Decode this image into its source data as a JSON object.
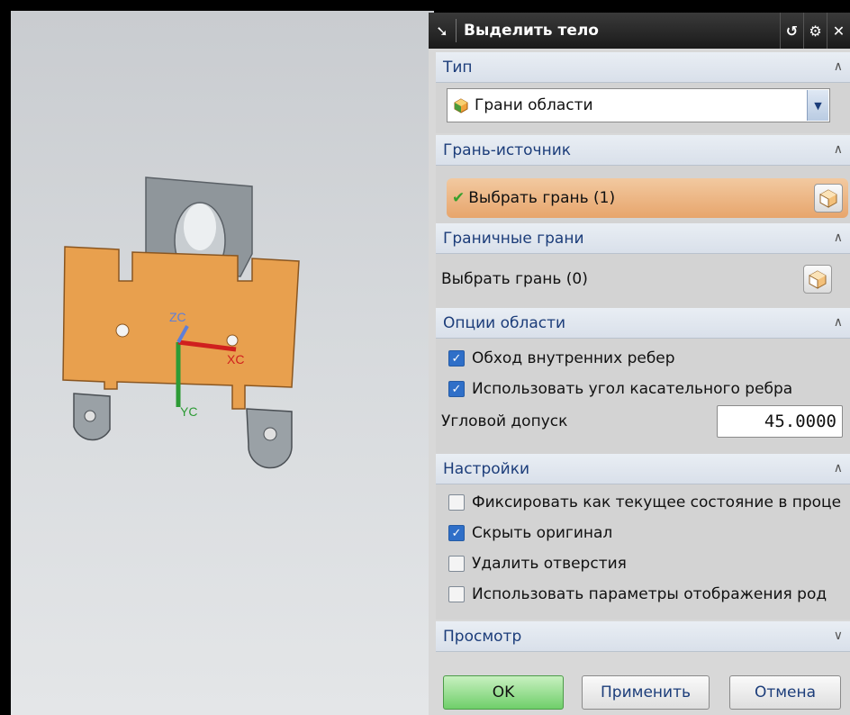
{
  "dialog": {
    "title": "Выделить тело",
    "title_buttons": [
      "reset-icon",
      "gear-icon",
      "close-icon"
    ]
  },
  "sections": {
    "type": {
      "header": "Тип",
      "combo_value": "Грани области"
    },
    "source_face": {
      "header": "Грань-источник",
      "select_label": "Выбрать грань (1)"
    },
    "boundary_faces": {
      "header": "Граничные грани",
      "select_label": "Выбрать грань (0)"
    },
    "region_options": {
      "header": "Опции области",
      "cb_internal_edges": "Обход внутренних ребер",
      "cb_tangent_angle": "Использовать угол касательного ребра",
      "angle_label": "Угловой допуск",
      "angle_value": "45.0000"
    },
    "settings": {
      "header": "Настройки",
      "cb_fix_state": "Фиксировать как текущее состояние в проце",
      "cb_hide_original": "Скрыть оригинал",
      "cb_delete_holes": "Удалить отверстия",
      "cb_display_params": "Использовать параметры отображения род"
    },
    "preview": {
      "header": "Просмотр"
    }
  },
  "checkbox_states": {
    "internal_edges": true,
    "tangent_angle": true,
    "fix_state": false,
    "hide_original": true,
    "delete_holes": false,
    "display_params": false
  },
  "buttons": {
    "ok": "OK",
    "apply": "Применить",
    "cancel": "Отмена"
  },
  "viewport": {
    "axis_labels": {
      "zc": "ZC",
      "xc": "XC",
      "yc": "YC"
    },
    "colors": {
      "part_face": "#e8a04e",
      "part_body": "#9aa1a6",
      "x_axis": "#d0201e",
      "y_axis": "#2d9b35",
      "z_axis": "#5f7fd8"
    }
  },
  "colors": {
    "title_bg": "#222222",
    "section_text": "#1c3d7a",
    "active_select": "#e7a56c",
    "ok_button": "#6fcf6a"
  }
}
